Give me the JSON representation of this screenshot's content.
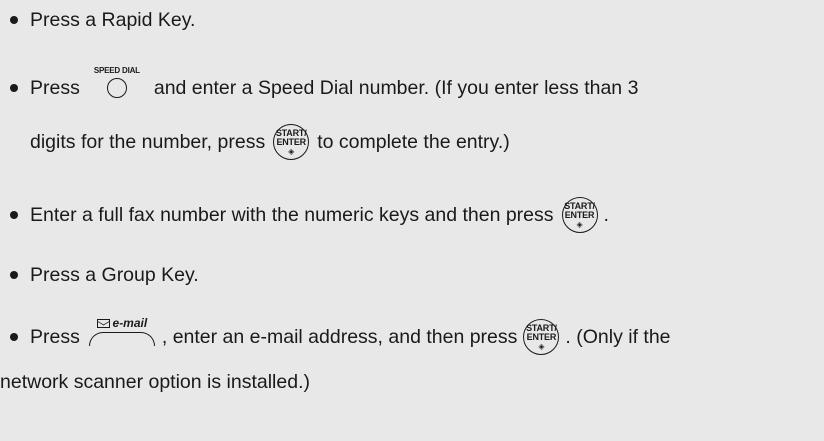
{
  "items": [
    {
      "text": "Press a Rapid Key."
    },
    {
      "before": "Press",
      "speed_dial_label": "SPEED DIAL",
      "after": "and enter a Speed Dial number. (If you enter less than 3",
      "cont_before": "digits for the number, press",
      "cont_after": "to complete the entry.)"
    },
    {
      "before": "Enter a full fax number with the numeric keys and then press",
      "after": "."
    },
    {
      "text": "Press a Group Key."
    },
    {
      "before": "Press",
      "email_label": "e-mail",
      "middle": ", enter an e-mail address, and then press",
      "after": ". (Only if the",
      "cont": "network scanner option is installed.)"
    }
  ],
  "start_key": {
    "line1": "START/",
    "line2": "ENTER",
    "symbol": "◈"
  }
}
